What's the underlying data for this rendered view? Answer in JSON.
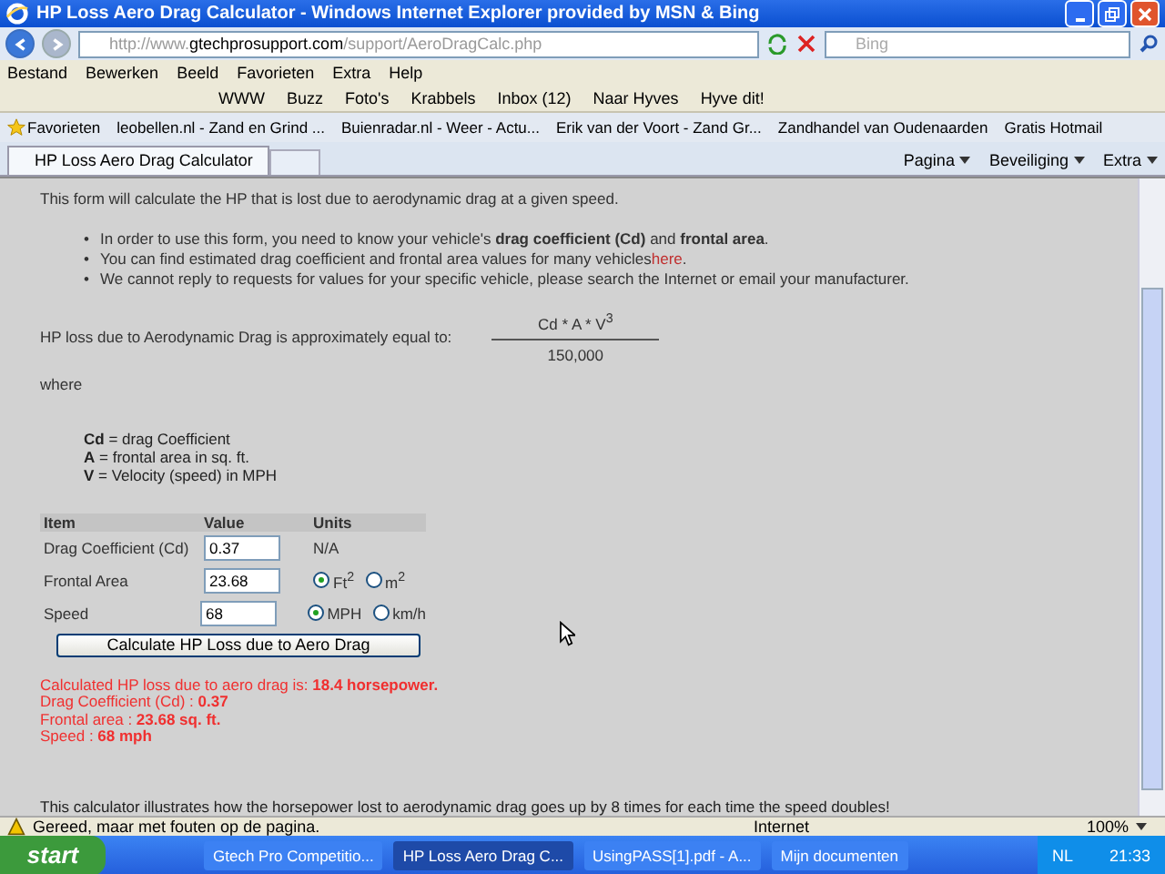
{
  "window": {
    "title": "HP Loss Aero Drag Calculator - Windows Internet Explorer provided by MSN & Bing"
  },
  "address": {
    "prefix": "http://www.",
    "host": "gtechprosupport.com",
    "path": "/support/AeroDragCalc.php"
  },
  "search": {
    "placeholder": "Bing"
  },
  "menu": [
    "Bestand",
    "Bewerken",
    "Beeld",
    "Favorieten",
    "Extra",
    "Help"
  ],
  "toolbar": [
    "WWW",
    "Buzz",
    "Foto's",
    "Krabbels",
    "Inbox (12)",
    "Naar Hyves",
    "Hyve dit!"
  ],
  "favorites": {
    "label": "Favorieten",
    "links": [
      "leobellen.nl - Zand en Grind ...",
      "Buienradar.nl - Weer - Actu...",
      "Erik van der Voort - Zand Gr...",
      "Zandhandel van Oudenaarden",
      "Gratis Hotmail"
    ]
  },
  "tabs": [
    {
      "label": "HP Loss Aero Drag Calculator",
      "selected": true
    }
  ],
  "commands": [
    "Pagina",
    "Beveiliging",
    "Extra"
  ],
  "page": {
    "intro": "This form will calculate the HP that is lost due to aerodynamic drag at a given speed.",
    "bullets": [
      {
        "marker": "•",
        "text": "In order to use this form, you need to know your vehicle's **drag coefficient (Cd)** and **frontal area**."
      },
      {
        "marker": "•",
        "text": "You can find estimated drag coefficient and frontal area values for many vehicles",
        "link": "here",
        "after": "."
      },
      {
        "marker": "•",
        "text": "We cannot reply to requests for values for your specific vehicle, please search the Internet or email your manufacturer."
      }
    ],
    "formula_label": "HP loss due to Aerodynamic Drag is approximately equal to:",
    "numerator": "Cd * A * V$^{3}$",
    "denominator": "150,000",
    "where": "where",
    "definitions": [
      "**Cd** = drag Coefficient",
      "**A** = frontal area in sq. ft.",
      "**V** = Velocity (speed) in MPH"
    ],
    "columns": [
      "Item",
      "Value",
      "Units"
    ],
    "rows": [
      {
        "label": "Drag Coefficient (Cd)",
        "value": "0.37",
        "kind": "text",
        "units": "N/A"
      },
      {
        "label": "Frontal Area",
        "value": "23.68",
        "kind": "radio",
        "options": [
          {
            "label": "Ft$^{2}$",
            "selected": true
          },
          {
            "label": "m$^{2}$",
            "selected": false
          }
        ]
      },
      {
        "label": "Speed",
        "value": "68",
        "kind": "radio",
        "options": [
          {
            "label": "MPH",
            "selected": true
          },
          {
            "label": "km/h",
            "selected": false
          }
        ]
      }
    ],
    "button": "Calculate HP Loss due to Aero Drag",
    "results": [
      "Calculated HP loss due to aero drag is: **18.4 horsepower.**",
      "Drag Coefficient (Cd) : **0.37**",
      "Frontal area : **23.68 sq. ft.**",
      "Speed : **68 mph**"
    ],
    "footer": "This calculator illustrates how the horsepower lost to aerodynamic drag goes up by 8 times for each time the speed doubles!"
  },
  "status_bar": {
    "text": "Gereed, maar met fouten op de pagina.",
    "zone": "Internet",
    "zoom": "100%"
  },
  "taskbar": {
    "start": "start",
    "tasks": [
      {
        "label": "Gtech Pro Competitio...",
        "selected": false
      },
      {
        "label": "HP Loss Aero Drag C...",
        "selected": true
      },
      {
        "label": "UsingPASS[1].pdf - A...",
        "selected": false
      },
      {
        "label": "Mijn documenten",
        "selected": false
      }
    ],
    "language": "NL",
    "clock": "21:33"
  }
}
